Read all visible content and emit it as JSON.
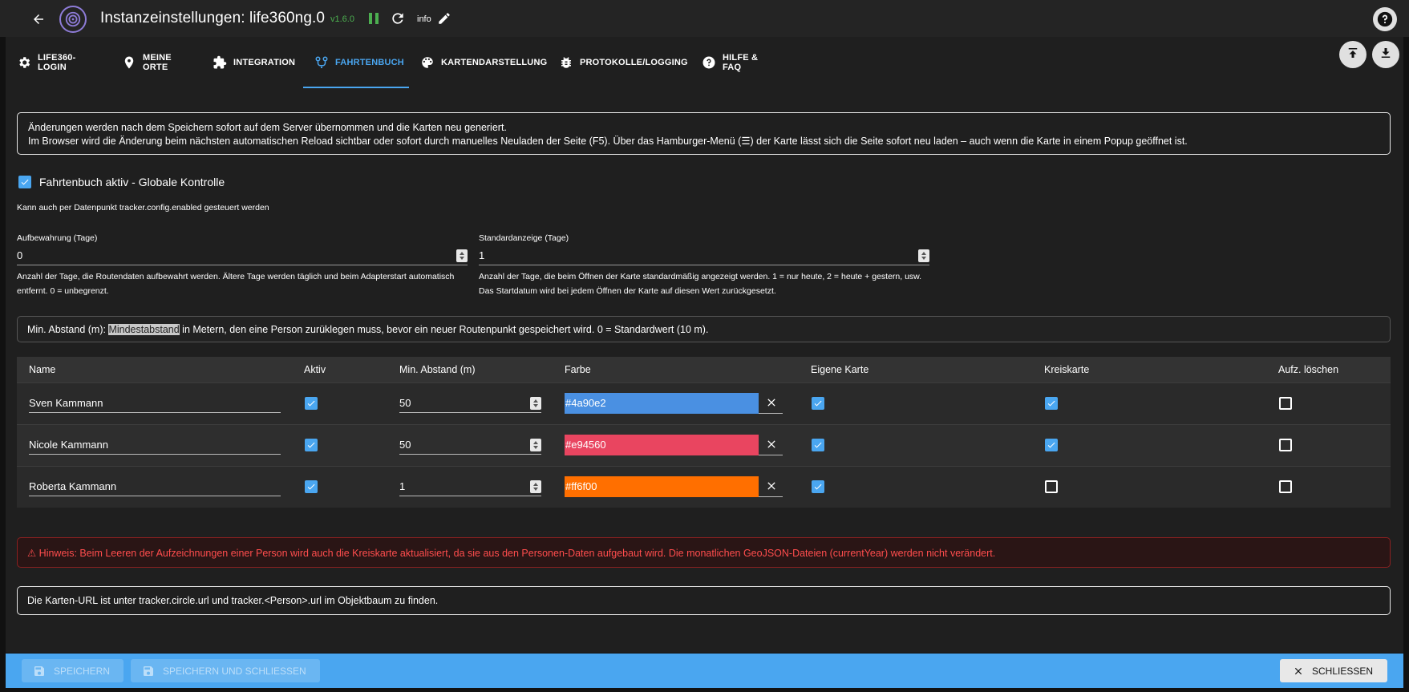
{
  "header": {
    "title": "Instanzeinstellungen: life360ng.0",
    "version": "v1.6.0",
    "info_label": "info"
  },
  "tabs": [
    {
      "label": "LIFE360-LOGIN",
      "icon": "gear-icon"
    },
    {
      "label": "MEINE ORTE",
      "icon": "map-pin-icon"
    },
    {
      "label": "INTEGRATION",
      "icon": "puzzle-icon"
    },
    {
      "label": "FAHRTENBUCH",
      "icon": "route-icon",
      "active": true
    },
    {
      "label": "KARTENDARSTELLUNG",
      "icon": "palette-icon"
    },
    {
      "label": "PROTOKOLLE/LOGGING",
      "icon": "bug-icon"
    },
    {
      "label": "HILFE & FAQ",
      "icon": "help-circle-icon"
    }
  ],
  "info_box": {
    "line1": "Änderungen werden nach dem Speichern sofort auf dem Server übernommen und die Karten neu generiert.",
    "line2": "Im Browser wird die Änderung beim nächsten automatischen Reload sichtbar oder sofort durch manuelles Neuladen der Seite (F5). Über das Hamburger-Menü (☰) der Karte lässt sich die Seite sofort neu laden – auch wenn die Karte in einem Popup geöffnet ist."
  },
  "global_control": {
    "label": "Fahrtenbuch aktiv - Globale Kontrolle",
    "checked": true,
    "hint": "Kann auch per Datenpunkt tracker.config.enabled gesteuert werden"
  },
  "retention": {
    "label": "Aufbewahrung (Tage)",
    "value": "0",
    "help": "Anzahl der Tage, die Routendaten aufbewahrt werden. Ältere Tage werden täglich und beim Adapterstart automatisch entfernt. 0 = unbegrenzt."
  },
  "default_display": {
    "label": "Standardanzeige (Tage)",
    "value": "1",
    "help": "Anzahl der Tage, die beim Öffnen der Karte standardmäßig angezeigt werden. 1 = nur heute, 2 = heute + gestern, usw. Das Startdatum wird bei jedem Öffnen der Karte auf diesen Wert zurückgesetzt."
  },
  "min_distance_box": {
    "prefix": "Min. Abstand (m): ",
    "highlight": "Mindestabstand",
    "suffix": " in Metern, den eine Person zurüklegen muss, bevor ein neuer Routenpunkt gespeichert wird. 0 = Standardwert (10 m)."
  },
  "table": {
    "headers": {
      "name": "Name",
      "active": "Aktiv",
      "min_distance": "Min. Abstand (m)",
      "color": "Farbe",
      "own_map": "Eigene Karte",
      "circle_map": "Kreiskarte",
      "clear": "Aufz. löschen"
    },
    "rows": [
      {
        "name": "Sven Kammann",
        "active": true,
        "min_distance": "50",
        "color": "#4a90e2",
        "own_map": true,
        "circle_map": true,
        "clear": false
      },
      {
        "name": "Nicole Kammann",
        "active": true,
        "min_distance": "50",
        "color": "#e94560",
        "own_map": true,
        "circle_map": true,
        "clear": false
      },
      {
        "name": "Roberta Kammann",
        "active": true,
        "min_distance": "1",
        "color": "#ff6f00",
        "own_map": true,
        "circle_map": false,
        "clear": false
      }
    ]
  },
  "warning": "⚠ Hinweis: Beim Leeren der Aufzeichnungen einer Person wird auch die Kreiskarte aktualisiert, da sie aus den Personen-Daten aufgebaut wird. Die monatlichen GeoJSON-Dateien (currentYear) werden nicht verändert.",
  "url_hint": "Die Karten-URL ist unter tracker.circle.url und tracker.<Person>.url im Objektbaum zu finden.",
  "footer": {
    "save_label": "SPEICHERN",
    "save_close_label": "SPEICHERN UND SCHLIESSEN",
    "close_label": "SCHLIESSEN"
  },
  "colors": {
    "accent": "#4aa6f0",
    "version": "#4caf50",
    "warning": "#ff4d4d"
  }
}
